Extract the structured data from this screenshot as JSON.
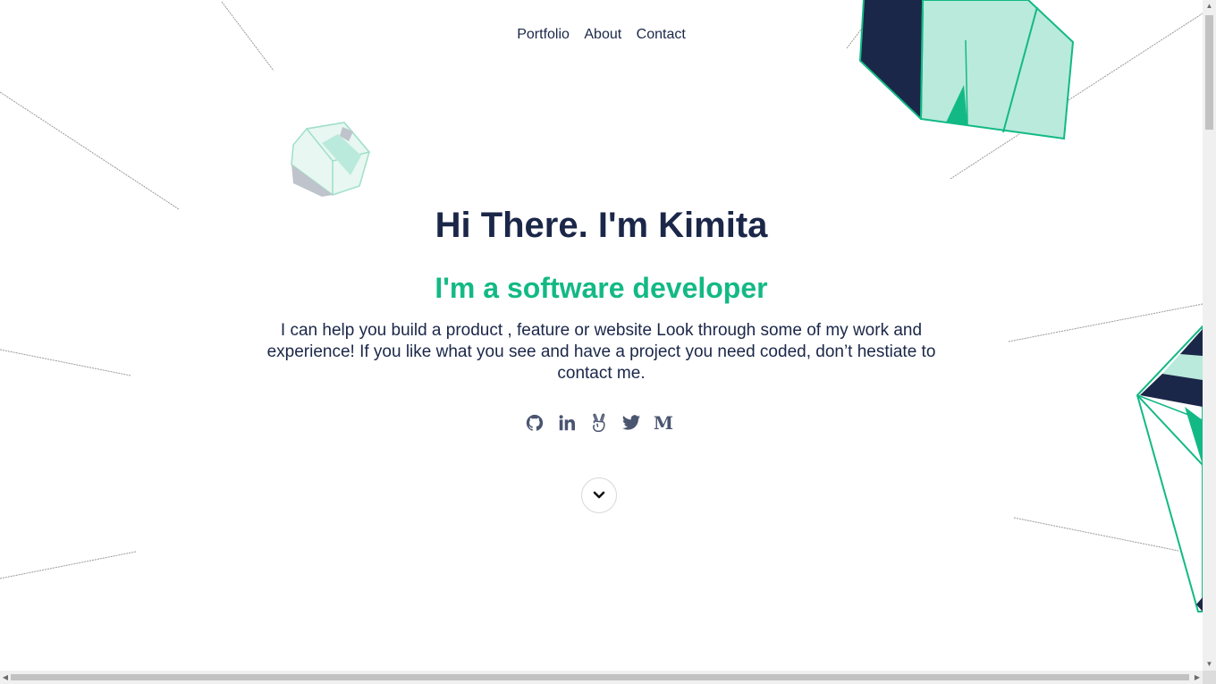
{
  "nav": {
    "items": [
      "Portfolio",
      "About",
      "Contact"
    ]
  },
  "hero": {
    "title": "Hi There. I'm Kimita",
    "subtitle": "I'm a software developer",
    "description": "I can help you build a product , feature or website Look through some of my work and experience! If you like what you see and have a project you need coded, don’t hestiate to contact me."
  },
  "socials": [
    "github-icon",
    "linkedin-icon",
    "angellist-icon",
    "twitter-icon",
    "medium-icon"
  ],
  "medium_letter": "M",
  "scroll_icon": "chevron-down-icon",
  "colors": {
    "navy": "#1b2749",
    "accent": "#13b985",
    "mint": "#b9eadb",
    "line": "#9a9a9a"
  }
}
